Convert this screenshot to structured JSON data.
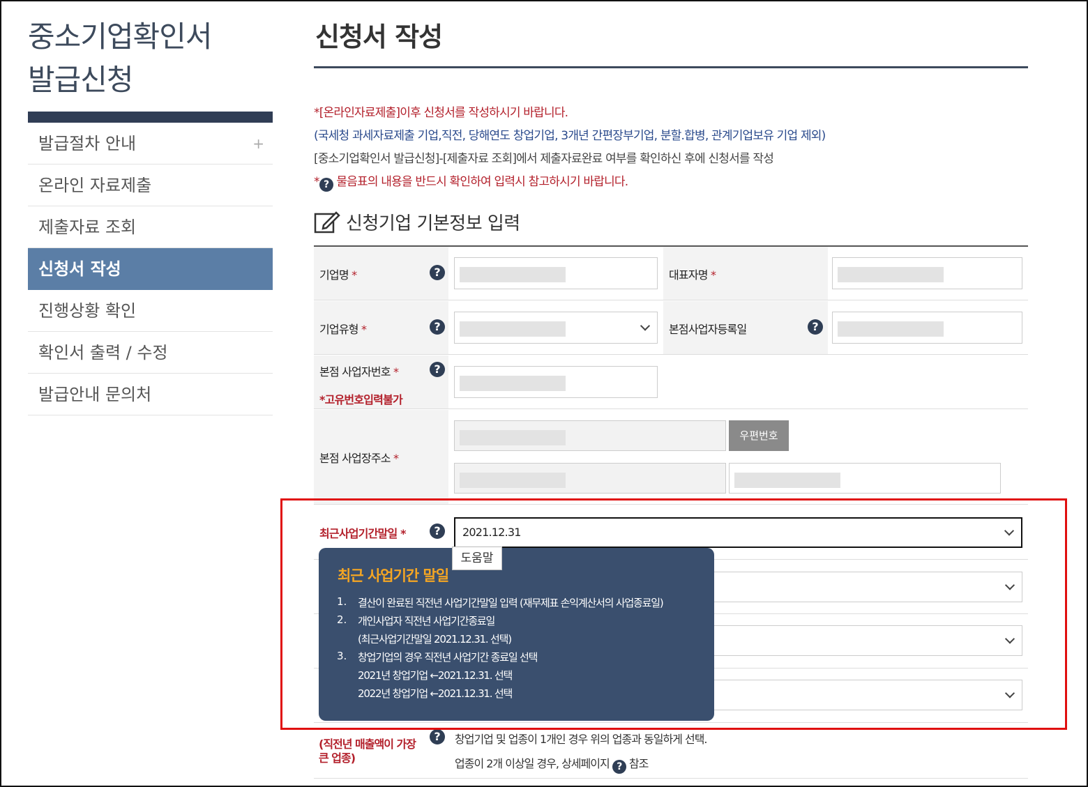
{
  "sidebar": {
    "title_line1": "중소기업확인서",
    "title_line2": "발급신청",
    "items": [
      {
        "label": "발급절차 안내",
        "plus": "+"
      },
      {
        "label": "온라인 자료제출"
      },
      {
        "label": "제출자료 조회"
      },
      {
        "label": "신청서 작성"
      },
      {
        "label": "진행상황 확인"
      },
      {
        "label": "확인서 출력 / 수정"
      },
      {
        "label": "발급안내 문의처"
      }
    ],
    "active_index": 3
  },
  "main": {
    "page_title": "신청서 작성",
    "notes": {
      "line1": "*[온라인자료제출]이후 신청서를 작성하시기 바랍니다.",
      "line2": "(국세청 과세자료제출 기업,직전, 당해연도 창업기업, 3개년 간편장부기업, 분할.합병, 관계기업보유 기업 제외)",
      "line3": "[중소기업확인서 발급신청]-[제출자료 조회]에서 제출자료완료 여부를 확인하신 후에 신청서를 작성",
      "line4_prefix": "*",
      "line4_icon": "?",
      "line4": "물음표의 내용을 반드시 확인하여 입력시 참고하시기 바랍니다."
    },
    "section_title": "신청기업 기본정보 입력",
    "form": {
      "company_name_label": "기업명",
      "ceo_label": "대표자명",
      "company_type_label": "기업유형",
      "hq_reg_date_label": "본점사업자등록일",
      "hq_biz_no_label": "본점 사업자번호",
      "hq_biz_no_note": "*고유번호입력불가",
      "hq_address_label": "본점 사업장주소",
      "zip_button": "우편번호",
      "fiscal_end_label": "최근사업기간말일",
      "fiscal_end_value": "2021.12.31",
      "required_mark": "*",
      "help_icon": "?"
    },
    "tooltip": {
      "tab": "도움말",
      "title": "최근 사업기간 말일",
      "items": [
        {
          "num": "1.",
          "text": "결산이 완료된 직전년 사업기간말일 입력 (재무제표 손익계산서의 사업종료일)"
        },
        {
          "num": "2.",
          "text": "개인사업자 직전년 사업기간종료일",
          "sub": "(최근사업기간말일 2021.12.31. 선택)"
        },
        {
          "num": "3.",
          "text": "창업기업의 경우 직전년 사업기간 종료일 선택",
          "sub": "2021년 창업기업 ←2021.12.31. 선택",
          "sub2": "2022년 창업기업 ←2021.12.31. 선택"
        }
      ]
    },
    "bottom": {
      "label": "(직전년 매출액이 가장 큰 업종)",
      "line1": "창업기업 및 업종이 1개인 경우 위의 업종과 동일하게 선택.",
      "line2": "업종이 2개 이상일 경우, 상세페이지",
      "line2_suffix": "참조"
    }
  },
  "colors": {
    "nav_dark": "#303d55",
    "nav_active": "#5b7ea6",
    "tooltip_bg": "#3a4f6e",
    "tooltip_title": "#f5a623",
    "highlight_box": "#e01010",
    "required_red": "#b3202b",
    "note_blue": "#2a4a8c"
  }
}
